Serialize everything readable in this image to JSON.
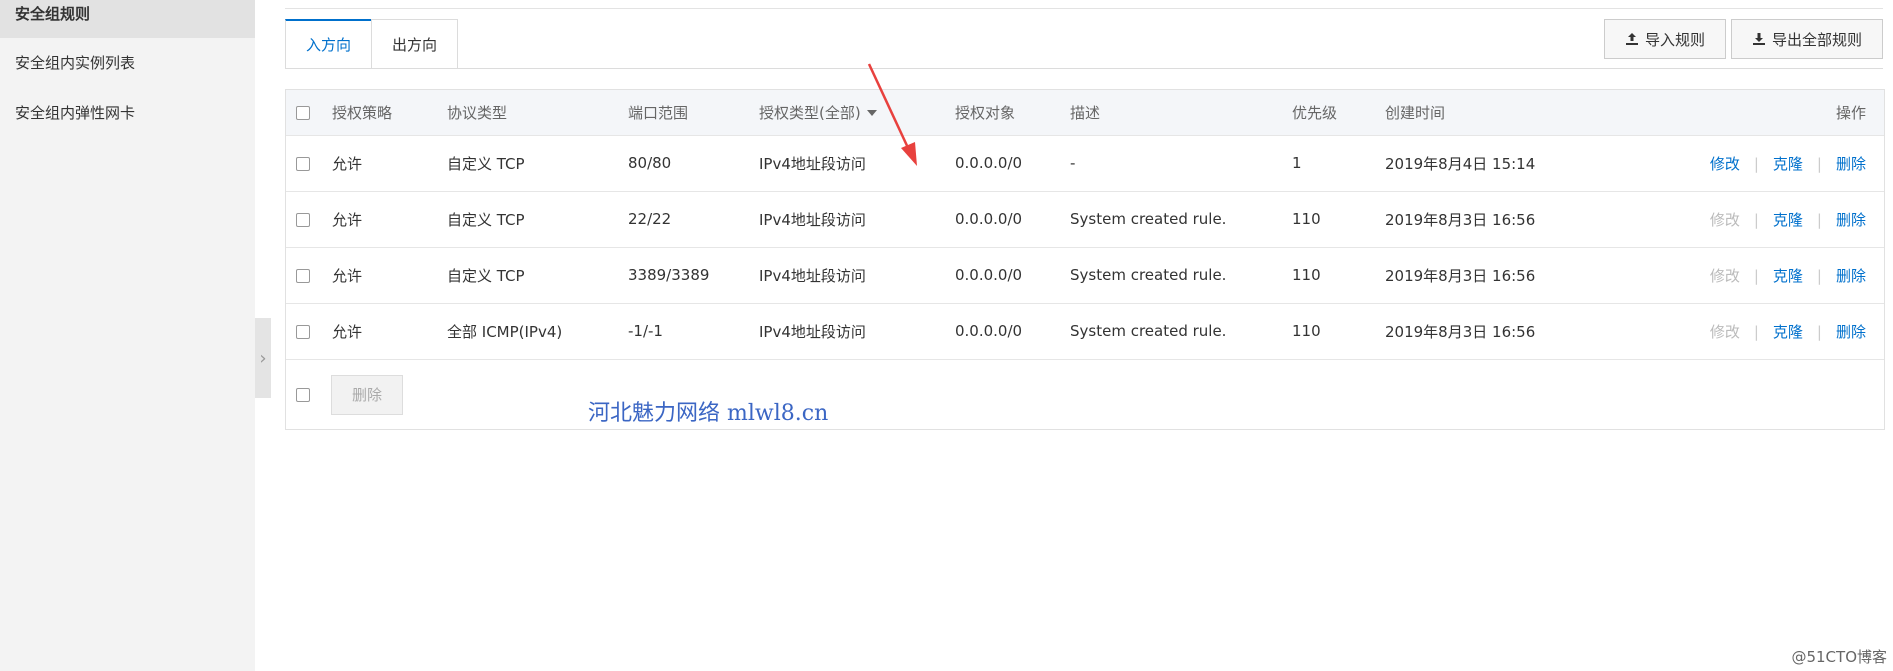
{
  "sidebar": {
    "items": [
      {
        "label": "安全组规则",
        "active": true
      },
      {
        "label": "安全组内实例列表",
        "active": false
      },
      {
        "label": "安全组内弹性网卡",
        "active": false
      }
    ]
  },
  "tabs": [
    {
      "label": "入方向",
      "active": true
    },
    {
      "label": "出方向",
      "active": false
    }
  ],
  "toolbar": {
    "import_label": "导入规则",
    "export_label": "导出全部规则"
  },
  "table": {
    "headers": {
      "policy": "授权策略",
      "protocol": "协议类型",
      "port_range": "端口范围",
      "auth_type": "授权类型(全部)",
      "auth_object": "授权对象",
      "description": "描述",
      "priority": "优先级",
      "created": "创建时间",
      "ops": "操作"
    },
    "rows": [
      {
        "policy": "允许",
        "protocol": "自定义 TCP",
        "port_range": "80/80",
        "auth_type": "IPv4地址段访问",
        "auth_object": "0.0.0.0/0",
        "description": "-",
        "priority": "1",
        "created": "2019年8月4日 15:14",
        "edit": "修改",
        "clone": "克隆",
        "delete": "删除",
        "edit_enabled": true
      },
      {
        "policy": "允许",
        "protocol": "自定义 TCP",
        "port_range": "22/22",
        "auth_type": "IPv4地址段访问",
        "auth_object": "0.0.0.0/0",
        "description": "System created rule.",
        "priority": "110",
        "created": "2019年8月3日 16:56",
        "edit": "修改",
        "clone": "克隆",
        "delete": "删除",
        "edit_enabled": false
      },
      {
        "policy": "允许",
        "protocol": "自定义 TCP",
        "port_range": "3389/3389",
        "auth_type": "IPv4地址段访问",
        "auth_object": "0.0.0.0/0",
        "description": "System created rule.",
        "priority": "110",
        "created": "2019年8月3日 16:56",
        "edit": "修改",
        "clone": "克隆",
        "delete": "删除",
        "edit_enabled": false
      },
      {
        "policy": "允许",
        "protocol": "全部 ICMP(IPv4)",
        "port_range": "-1/-1",
        "auth_type": "IPv4地址段访问",
        "auth_object": "0.0.0.0/0",
        "description": "System created rule.",
        "priority": "110",
        "created": "2019年8月3日 16:56",
        "edit": "修改",
        "clone": "克隆",
        "delete": "删除",
        "edit_enabled": false
      }
    ],
    "bulk_delete_label": "删除"
  },
  "watermark": "河北魅力网络 mlwl8.cn",
  "corner_mark": "@51CTO博客",
  "colors": {
    "accent": "#0070cc",
    "arrow": "#e8413e",
    "disabled": "#bbbbbb"
  }
}
